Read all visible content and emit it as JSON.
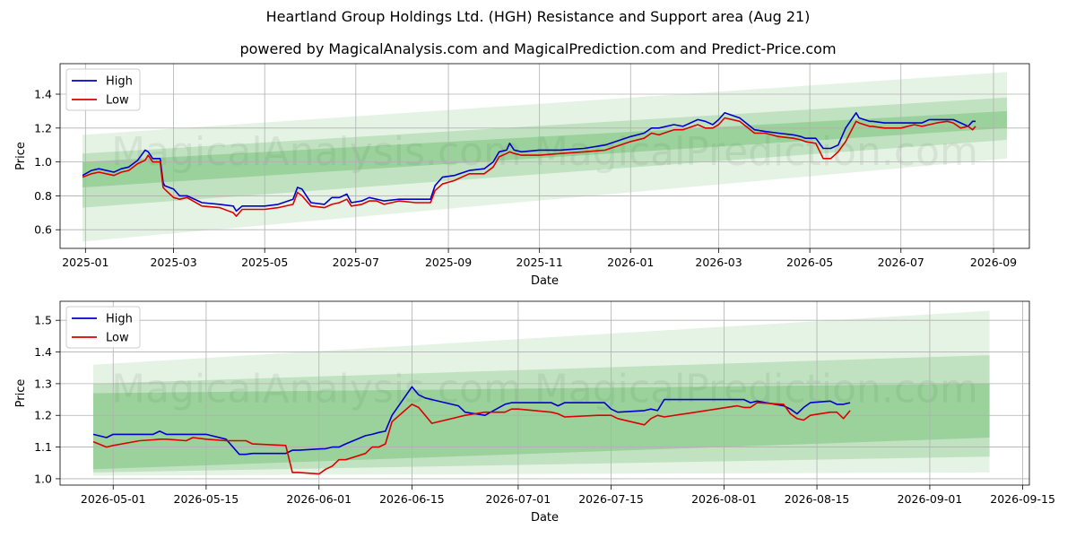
{
  "title": "Heartland Group Holdings Ltd. (HGH) Resistance and Support area (Aug 21)",
  "subtitle": "powered by MagicalAnalysis.com and MagicalPrediction.com and Predict-Price.com",
  "watermark_text": "MagicalAnalysis.com   MagicalPrediction.com",
  "colors": {
    "high": "#0000cc",
    "low": "#dd0000",
    "band": "#2ca02c",
    "grid": "#b0b0b0"
  },
  "chart_data": [
    {
      "type": "line",
      "xlabel": "Date",
      "ylabel": "Price",
      "xlim": [
        "2024-12-15",
        "2026-09-25"
      ],
      "ylim": [
        0.49,
        1.58
      ],
      "grid": true,
      "legend_position": "top-left",
      "x_tick_labels": [
        "2025-01",
        "2025-03",
        "2025-05",
        "2025-07",
        "2025-09",
        "2025-11",
        "2026-01",
        "2026-03",
        "2026-05",
        "2026-07",
        "2026-09"
      ],
      "x_tick_dates": [
        "2025-01-01",
        "2025-03-01",
        "2025-05-01",
        "2025-07-01",
        "2025-09-01",
        "2025-11-01",
        "2026-01-01",
        "2026-03-01",
        "2026-05-01",
        "2026-07-01",
        "2026-09-01"
      ],
      "y_ticks": [
        0.6,
        0.8,
        1.0,
        1.2,
        1.4
      ],
      "y_tick_labels": [
        "0.6",
        "0.8",
        "1.0",
        "1.2",
        "1.4"
      ],
      "bands": [
        {
          "x": [
            "2024-12-30",
            "2026-09-10"
          ],
          "upper": [
            1.16,
            1.53
          ],
          "lower": [
            0.53,
            1.02
          ]
        },
        {
          "x": [
            "2024-12-30",
            "2026-09-10"
          ],
          "upper": [
            1.05,
            1.38
          ],
          "lower": [
            0.73,
            1.13
          ]
        },
        {
          "x": [
            "2024-12-30",
            "2026-09-10"
          ],
          "upper": [
            1.0,
            1.3
          ],
          "lower": [
            0.85,
            1.2
          ]
        }
      ],
      "series": [
        {
          "name": "High",
          "x": [
            "2024-12-30",
            "2025-01-05",
            "2025-01-10",
            "2025-01-20",
            "2025-01-25",
            "2025-01-30",
            "2025-02-05",
            "2025-02-10",
            "2025-02-12",
            "2025-02-15",
            "2025-02-20",
            "2025-02-22",
            "2025-02-23",
            "2025-03-01",
            "2025-03-05",
            "2025-03-10",
            "2025-03-20",
            "2025-04-01",
            "2025-04-10",
            "2025-04-12",
            "2025-04-16",
            "2025-04-20",
            "2025-05-01",
            "2025-05-10",
            "2025-05-20",
            "2025-05-23",
            "2025-05-26",
            "2025-06-01",
            "2025-06-10",
            "2025-06-15",
            "2025-06-20",
            "2025-06-25",
            "2025-06-28",
            "2025-07-05",
            "2025-07-10",
            "2025-07-15",
            "2025-07-20",
            "2025-07-30",
            "2025-08-10",
            "2025-08-20",
            "2025-08-23",
            "2025-08-28",
            "2025-09-05",
            "2025-09-15",
            "2025-09-25",
            "2025-10-01",
            "2025-10-05",
            "2025-10-10",
            "2025-10-12",
            "2025-10-15",
            "2025-10-20",
            "2025-11-01",
            "2025-11-15",
            "2025-12-01",
            "2025-12-15",
            "2026-01-01",
            "2026-01-10",
            "2026-01-15",
            "2026-01-20",
            "2026-01-30",
            "2026-02-05",
            "2026-02-15",
            "2026-02-20",
            "2026-02-25",
            "2026-03-01",
            "2026-03-05",
            "2026-03-15",
            "2026-03-25",
            "2026-04-01",
            "2026-04-10",
            "2026-04-20",
            "2026-04-25",
            "2026-04-28",
            "2026-05-05",
            "2026-05-10",
            "2026-05-15",
            "2026-05-20",
            "2026-05-25",
            "2026-06-01",
            "2026-06-03",
            "2026-06-10",
            "2026-06-12",
            "2026-06-20",
            "2026-07-01",
            "2026-07-10",
            "2026-07-15",
            "2026-07-20",
            "2026-07-25",
            "2026-08-01",
            "2026-08-05",
            "2026-08-10",
            "2026-08-15",
            "2026-08-18",
            "2026-08-20"
          ],
          "values": [
            0.92,
            0.95,
            0.96,
            0.94,
            0.96,
            0.97,
            1.01,
            1.07,
            1.06,
            1.02,
            1.02,
            0.88,
            0.86,
            0.84,
            0.8,
            0.8,
            0.76,
            0.75,
            0.74,
            0.71,
            0.74,
            0.74,
            0.74,
            0.75,
            0.78,
            0.85,
            0.84,
            0.76,
            0.75,
            0.79,
            0.79,
            0.81,
            0.76,
            0.77,
            0.79,
            0.78,
            0.77,
            0.78,
            0.78,
            0.78,
            0.86,
            0.91,
            0.92,
            0.95,
            0.96,
            1.0,
            1.06,
            1.07,
            1.11,
            1.07,
            1.06,
            1.07,
            1.07,
            1.08,
            1.1,
            1.15,
            1.17,
            1.2,
            1.2,
            1.22,
            1.21,
            1.25,
            1.24,
            1.22,
            1.25,
            1.29,
            1.26,
            1.19,
            1.18,
            1.17,
            1.16,
            1.15,
            1.14,
            1.14,
            1.08,
            1.08,
            1.1,
            1.2,
            1.29,
            1.26,
            1.24,
            1.24,
            1.23,
            1.23,
            1.23,
            1.23,
            1.25,
            1.25,
            1.25,
            1.25,
            1.23,
            1.21,
            1.24,
            1.24
          ]
        },
        {
          "name": "Low",
          "x": [
            "2024-12-30",
            "2025-01-05",
            "2025-01-10",
            "2025-01-20",
            "2025-01-25",
            "2025-01-30",
            "2025-02-05",
            "2025-02-10",
            "2025-02-12",
            "2025-02-15",
            "2025-02-20",
            "2025-02-22",
            "2025-02-23",
            "2025-03-01",
            "2025-03-05",
            "2025-03-10",
            "2025-03-20",
            "2025-04-01",
            "2025-04-10",
            "2025-04-12",
            "2025-04-16",
            "2025-04-20",
            "2025-05-01",
            "2025-05-10",
            "2025-05-20",
            "2025-05-23",
            "2025-05-26",
            "2025-06-01",
            "2025-06-10",
            "2025-06-15",
            "2025-06-20",
            "2025-06-25",
            "2025-06-28",
            "2025-07-05",
            "2025-07-10",
            "2025-07-15",
            "2025-07-20",
            "2025-07-30",
            "2025-08-10",
            "2025-08-20",
            "2025-08-23",
            "2025-08-28",
            "2025-09-05",
            "2025-09-15",
            "2025-09-25",
            "2025-10-01",
            "2025-10-05",
            "2025-10-10",
            "2025-10-12",
            "2025-10-15",
            "2025-10-20",
            "2025-11-01",
            "2025-11-15",
            "2025-12-01",
            "2025-12-15",
            "2026-01-01",
            "2026-01-10",
            "2026-01-15",
            "2026-01-20",
            "2026-01-30",
            "2026-02-05",
            "2026-02-15",
            "2026-02-20",
            "2026-02-25",
            "2026-03-01",
            "2026-03-05",
            "2026-03-15",
            "2026-03-25",
            "2026-04-01",
            "2026-04-10",
            "2026-04-20",
            "2026-04-25",
            "2026-04-28",
            "2026-05-05",
            "2026-05-10",
            "2026-05-15",
            "2026-05-20",
            "2026-05-25",
            "2026-06-01",
            "2026-06-03",
            "2026-06-10",
            "2026-06-12",
            "2026-06-20",
            "2026-07-01",
            "2026-07-10",
            "2026-07-15",
            "2026-07-20",
            "2026-07-25",
            "2026-08-01",
            "2026-08-05",
            "2026-08-10",
            "2026-08-15",
            "2026-08-18",
            "2026-08-20"
          ],
          "values": [
            0.91,
            0.93,
            0.94,
            0.92,
            0.94,
            0.95,
            0.99,
            1.01,
            1.04,
            1.0,
            1.0,
            0.85,
            0.84,
            0.79,
            0.78,
            0.79,
            0.74,
            0.73,
            0.7,
            0.68,
            0.72,
            0.72,
            0.72,
            0.73,
            0.75,
            0.82,
            0.8,
            0.74,
            0.73,
            0.75,
            0.76,
            0.78,
            0.74,
            0.75,
            0.77,
            0.77,
            0.75,
            0.77,
            0.76,
            0.76,
            0.83,
            0.87,
            0.89,
            0.93,
            0.93,
            0.97,
            1.03,
            1.05,
            1.06,
            1.05,
            1.04,
            1.04,
            1.05,
            1.06,
            1.07,
            1.12,
            1.14,
            1.17,
            1.16,
            1.19,
            1.19,
            1.22,
            1.2,
            1.2,
            1.22,
            1.26,
            1.24,
            1.17,
            1.17,
            1.15,
            1.14,
            1.13,
            1.12,
            1.11,
            1.02,
            1.02,
            1.06,
            1.12,
            1.24,
            1.23,
            1.21,
            1.21,
            1.2,
            1.2,
            1.22,
            1.21,
            1.22,
            1.23,
            1.24,
            1.23,
            1.2,
            1.21,
            1.19,
            1.21
          ]
        }
      ]
    },
    {
      "type": "line",
      "xlabel": "Date",
      "ylabel": "Price",
      "xlim": [
        "2026-04-23",
        "2026-09-16"
      ],
      "ylim": [
        0.98,
        1.56
      ],
      "grid": true,
      "legend_position": "top-left",
      "x_tick_labels": [
        "2026-05-01",
        "2026-05-15",
        "2026-06-01",
        "2026-06-15",
        "2026-07-01",
        "2026-07-15",
        "2026-08-01",
        "2026-08-15",
        "2026-09-01",
        "2026-09-15"
      ],
      "x_tick_dates": [
        "2026-05-01",
        "2026-05-15",
        "2026-06-01",
        "2026-06-15",
        "2026-07-01",
        "2026-07-15",
        "2026-08-01",
        "2026-08-15",
        "2026-09-01",
        "2026-09-15"
      ],
      "y_ticks": [
        1.0,
        1.1,
        1.2,
        1.3,
        1.4,
        1.5
      ],
      "y_tick_labels": [
        "1.0",
        "1.1",
        "1.2",
        "1.3",
        "1.4",
        "1.5"
      ],
      "bands": [
        {
          "x": [
            "2026-04-28",
            "2026-09-10"
          ],
          "upper": [
            1.36,
            1.53
          ],
          "lower": [
            1.01,
            1.02
          ]
        },
        {
          "x": [
            "2026-04-28",
            "2026-09-10"
          ],
          "upper": [
            1.3,
            1.39
          ],
          "lower": [
            1.02,
            1.07
          ]
        },
        {
          "x": [
            "2026-04-28",
            "2026-09-10"
          ],
          "upper": [
            1.27,
            1.3
          ],
          "lower": [
            1.03,
            1.13
          ]
        }
      ],
      "series": [
        {
          "name": "High",
          "x": [
            "2026-04-28",
            "2026-04-30",
            "2026-05-01",
            "2026-05-05",
            "2026-05-07",
            "2026-05-08",
            "2026-05-09",
            "2026-05-12",
            "2026-05-13",
            "2026-05-15",
            "2026-05-18",
            "2026-05-20",
            "2026-05-21",
            "2026-05-22",
            "2026-05-27",
            "2026-05-28",
            "2026-05-29",
            "2026-06-01",
            "2026-06-02",
            "2026-06-03",
            "2026-06-04",
            "2026-06-05",
            "2026-06-08",
            "2026-06-09",
            "2026-06-10",
            "2026-06-11",
            "2026-06-12",
            "2026-06-15",
            "2026-06-16",
            "2026-06-17",
            "2026-06-18",
            "2026-06-22",
            "2026-06-23",
            "2026-06-26",
            "2026-06-29",
            "2026-06-30",
            "2026-07-01",
            "2026-07-06",
            "2026-07-07",
            "2026-07-08",
            "2026-07-13",
            "2026-07-14",
            "2026-07-15",
            "2026-07-16",
            "2026-07-20",
            "2026-07-21",
            "2026-07-22",
            "2026-07-23",
            "2026-08-03",
            "2026-08-04",
            "2026-08-05",
            "2026-08-06",
            "2026-08-10",
            "2026-08-11",
            "2026-08-12",
            "2026-08-13",
            "2026-08-14",
            "2026-08-17",
            "2026-08-18",
            "2026-08-19",
            "2026-08-20"
          ],
          "values": [
            1.14,
            1.13,
            1.14,
            1.14,
            1.14,
            1.15,
            1.14,
            1.14,
            1.14,
            1.14,
            1.125,
            1.077,
            1.077,
            1.08,
            1.08,
            1.09,
            1.09,
            1.094,
            1.095,
            1.1,
            1.1,
            1.11,
            1.136,
            1.14,
            1.146,
            1.15,
            1.2,
            1.29,
            1.265,
            1.255,
            1.25,
            1.23,
            1.21,
            1.2,
            1.235,
            1.24,
            1.24,
            1.24,
            1.23,
            1.24,
            1.24,
            1.24,
            1.22,
            1.21,
            1.215,
            1.22,
            1.215,
            1.25,
            1.25,
            1.25,
            1.24,
            1.245,
            1.23,
            1.22,
            1.205,
            1.225,
            1.24,
            1.245,
            1.235,
            1.235,
            1.24
          ]
        },
        {
          "name": "Low",
          "x": [
            "2026-04-28",
            "2026-04-30",
            "2026-05-01",
            "2026-05-05",
            "2026-05-07",
            "2026-05-08",
            "2026-05-09",
            "2026-05-12",
            "2026-05-13",
            "2026-05-15",
            "2026-05-18",
            "2026-05-20",
            "2026-05-21",
            "2026-05-22",
            "2026-05-27",
            "2026-05-28",
            "2026-05-29",
            "2026-06-01",
            "2026-06-02",
            "2026-06-03",
            "2026-06-04",
            "2026-06-05",
            "2026-06-08",
            "2026-06-09",
            "2026-06-10",
            "2026-06-11",
            "2026-06-12",
            "2026-06-15",
            "2026-06-16",
            "2026-06-17",
            "2026-06-18",
            "2026-06-22",
            "2026-06-23",
            "2026-06-26",
            "2026-06-29",
            "2026-06-30",
            "2026-07-01",
            "2026-07-06",
            "2026-07-07",
            "2026-07-08",
            "2026-07-13",
            "2026-07-14",
            "2026-07-15",
            "2026-07-16",
            "2026-07-20",
            "2026-07-21",
            "2026-07-22",
            "2026-07-23",
            "2026-08-03",
            "2026-08-04",
            "2026-08-05",
            "2026-08-06",
            "2026-08-10",
            "2026-08-11",
            "2026-08-12",
            "2026-08-13",
            "2026-08-14",
            "2026-08-17",
            "2026-08-18",
            "2026-08-19",
            "2026-08-20"
          ],
          "values": [
            1.117,
            1.1,
            1.105,
            1.12,
            1.123,
            1.125,
            1.125,
            1.12,
            1.13,
            1.125,
            1.12,
            1.12,
            1.12,
            1.11,
            1.105,
            1.02,
            1.02,
            1.015,
            1.03,
            1.04,
            1.06,
            1.06,
            1.08,
            1.1,
            1.1,
            1.11,
            1.18,
            1.235,
            1.225,
            1.2,
            1.175,
            1.195,
            1.2,
            1.21,
            1.21,
            1.22,
            1.22,
            1.21,
            1.205,
            1.195,
            1.2,
            1.2,
            1.2,
            1.19,
            1.17,
            1.19,
            1.2,
            1.195,
            1.23,
            1.225,
            1.225,
            1.24,
            1.235,
            1.205,
            1.19,
            1.185,
            1.2,
            1.21,
            1.21,
            1.19,
            1.215
          ]
        }
      ]
    }
  ]
}
